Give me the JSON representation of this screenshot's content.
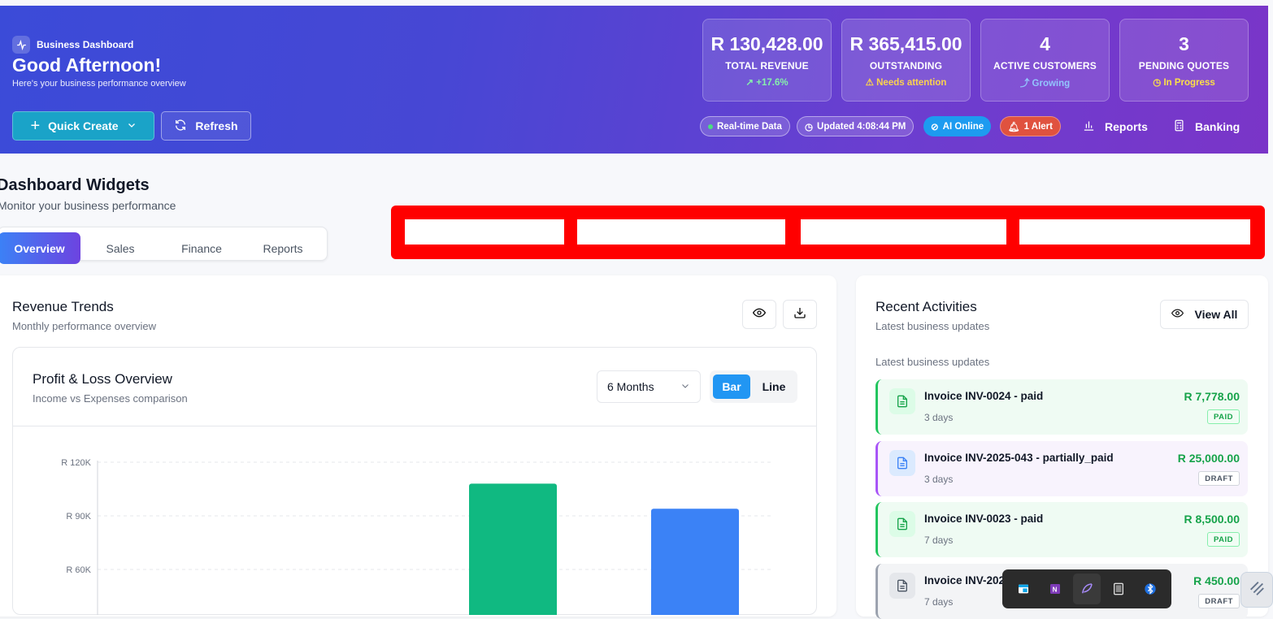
{
  "header": {
    "brand": "Business Dashboard",
    "greeting": "Good Afternoon!",
    "subtitle": "Here's your business performance overview",
    "quick_create": "Quick Create",
    "refresh": "Refresh"
  },
  "stats": [
    {
      "value": "R 130,428.00",
      "label": "TOTAL REVENUE",
      "tag": "+17.6%",
      "tag_color": "#86efac"
    },
    {
      "value": "R 365,415.00",
      "label": "OUTSTANDING",
      "tag": "Needs attention",
      "tag_color": "#fcd34d"
    },
    {
      "value": "4",
      "label": "ACTIVE CUSTOMERS",
      "tag": "Growing",
      "tag_color": "#93c5fd"
    },
    {
      "value": "3",
      "label": "PENDING QUOTES",
      "tag": "In Progress",
      "tag_color": "#fde047"
    }
  ],
  "status": {
    "realtime": "Real-time Data",
    "updated": "Updated 4:08:44 PM",
    "ai": "AI Online",
    "alert": "1 Alert"
  },
  "nav": {
    "reports": "Reports",
    "banking": "Banking"
  },
  "widgets": {
    "title": "Dashboard Widgets",
    "subtitle": "Monitor your business performance",
    "tabs": [
      "Overview",
      "Sales",
      "Finance",
      "Reports"
    ]
  },
  "revenue": {
    "title": "Revenue Trends",
    "subtitle": "Monthly performance overview",
    "chart_title": "Profit & Loss Overview",
    "chart_subtitle": "Income vs Expenses comparison",
    "period": "6 Months",
    "bar_label": "Bar",
    "line_label": "Line"
  },
  "chart_data": {
    "type": "bar",
    "ytick_labels": [
      "R 120K",
      "R 90K",
      "R 60K"
    ],
    "ylim": [
      30000,
      120000
    ],
    "series": [
      {
        "values": [
          108000
        ],
        "color": "#10b981"
      },
      {
        "values": [
          94000
        ],
        "color": "#3b82f6"
      }
    ],
    "grid": true
  },
  "activities": {
    "title": "Recent Activities",
    "subtitle": "Latest business updates",
    "view_all": "View All",
    "section_label": "Latest business updates",
    "items": [
      {
        "title": "Invoice INV-0024 - paid",
        "time": "3 days",
        "amount": "R 7,778.00",
        "badge": "PAID"
      },
      {
        "title": "Invoice INV-2025-043 - partially_paid",
        "time": "3 days",
        "amount": "R 25,000.00",
        "badge": "DRAFT"
      },
      {
        "title": "Invoice INV-0023 - paid",
        "time": "7 days",
        "amount": "R 8,500.00",
        "badge": "PAID"
      },
      {
        "title": "Invoice INV-202",
        "time": "7 days",
        "amount": "R 450.00",
        "badge": "DRAFT"
      }
    ]
  }
}
